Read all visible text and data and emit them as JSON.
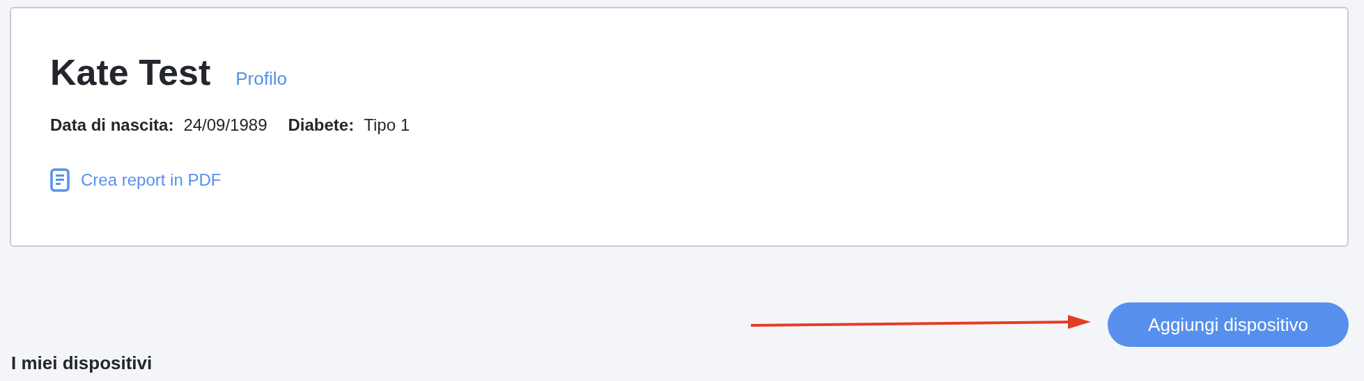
{
  "profile_card": {
    "name": "Kate Test",
    "profile_link": "Profilo",
    "details": [
      {
        "label": "Data di nascita:",
        "value": "24/09/1989"
      },
      {
        "label": "Diabete:",
        "value": "Tipo 1"
      }
    ],
    "report_link": "Crea report in PDF"
  },
  "add_device_button": "Aggiungi dispositivo",
  "section_title": "I miei dispositivi"
}
